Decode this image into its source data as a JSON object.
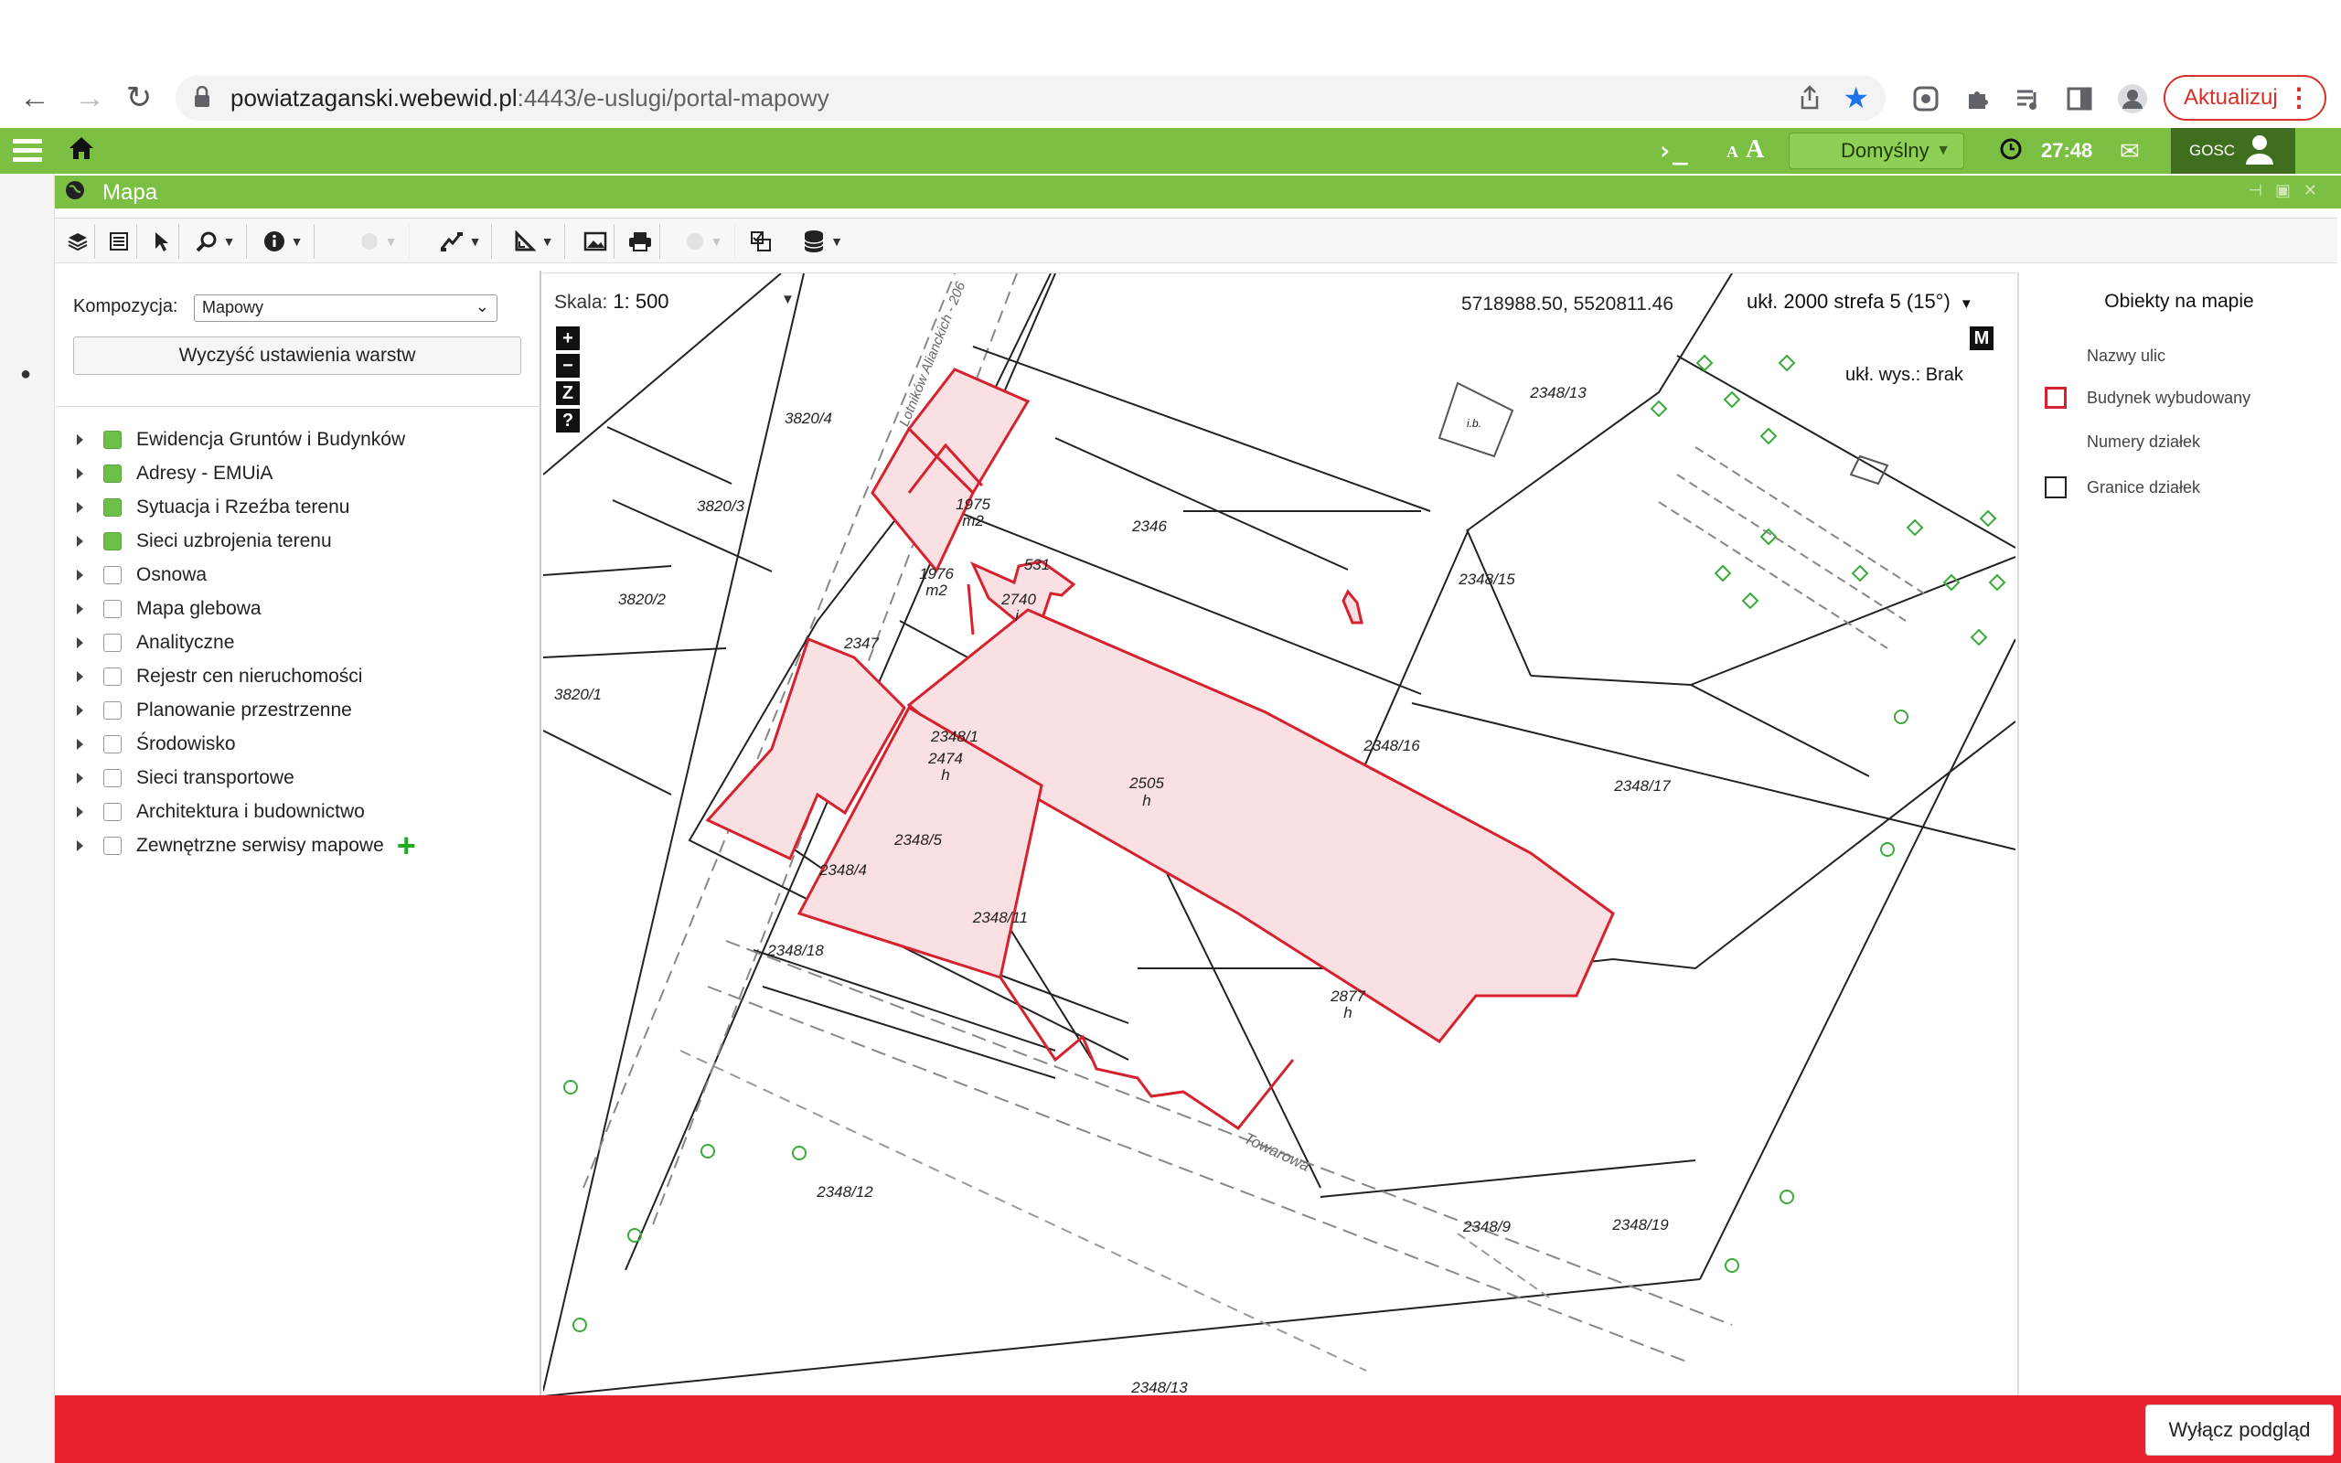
{
  "browser": {
    "url_host": "powiatzaganski.webewid.pl",
    "url_rest": ":4443/e-uslugi/portal-mapowy",
    "update_label": "Aktualizuj"
  },
  "appbar": {
    "profile_label": "Domyślny",
    "time": "27:48",
    "user_label": "GOSC",
    "font_small": "A",
    "font_large": "A",
    "terminal": "›_"
  },
  "window": {
    "title": "Mapa"
  },
  "panel": {
    "composition_label": "Kompozycja:",
    "composition_value": "Mapowy",
    "clear_label": "Wyczyść ustawienia warstw",
    "layers": [
      {
        "label": "Ewidencja Gruntów i Budynków",
        "checked": true
      },
      {
        "label": "Adresy - EMUiA",
        "checked": true
      },
      {
        "label": "Sytuacja i Rzeźba terenu",
        "checked": true
      },
      {
        "label": "Sieci uzbrojenia terenu",
        "checked": true
      },
      {
        "label": "Osnowa",
        "checked": false
      },
      {
        "label": "Mapa glebowa",
        "checked": false
      },
      {
        "label": "Analityczne",
        "checked": false
      },
      {
        "label": "Rejestr cen nieruchomości",
        "checked": false
      },
      {
        "label": "Planowanie przestrzenne",
        "checked": false
      },
      {
        "label": "Środowisko",
        "checked": false
      },
      {
        "label": "Sieci transportowe",
        "checked": false
      },
      {
        "label": "Architektura i budownictwo",
        "checked": false
      },
      {
        "label": "Zewnętrzne serwisy mapowe",
        "checked": false
      }
    ]
  },
  "map": {
    "scale_label": "Skala:",
    "scale_value": "1: 500",
    "coords": "5718988.50, 5520811.46",
    "crs": "ukł. 2000 strefa 5 (15°)",
    "height_system": "ukł. wys.: Brak",
    "m_badge": "M",
    "zoom_in": "+",
    "zoom_out": "−",
    "zoom_z": "Z",
    "help": "?",
    "street_names": [
      "Towarowa",
      "Lotników Alianckich - 206"
    ],
    "parcel_labels": [
      "3820/4",
      "3820/3",
      "3820/2",
      "3820/1",
      "1975",
      "m2",
      "1976",
      "m2",
      "2346",
      "2347",
      "531",
      "2740",
      "i",
      "2348/13",
      "2348/15",
      "2348/16",
      "2348/17",
      "2348/1",
      "2474",
      "h",
      "2505",
      "h",
      "2348/5",
      "2348/4",
      "2348/18",
      "2348/11",
      "2877",
      "h",
      "2348/9",
      "2348/12",
      "2348/19",
      "i.b.",
      "38",
      "38",
      "2",
      "3"
    ]
  },
  "legend": {
    "title": "Obiekty na mapie",
    "items": [
      {
        "label": "Nazwy ulic",
        "swatch": "none"
      },
      {
        "label": "Budynek wybudowany",
        "swatch": "red"
      },
      {
        "label": "Numery działek",
        "swatch": "none"
      },
      {
        "label": "Granice działek",
        "swatch": "black"
      }
    ]
  },
  "footer": {
    "preview_off_label": "Wyłącz podgląd"
  },
  "colors": {
    "green": "#7bc043",
    "red_bar": "#e8232f",
    "building_outline": "#d6222e"
  }
}
